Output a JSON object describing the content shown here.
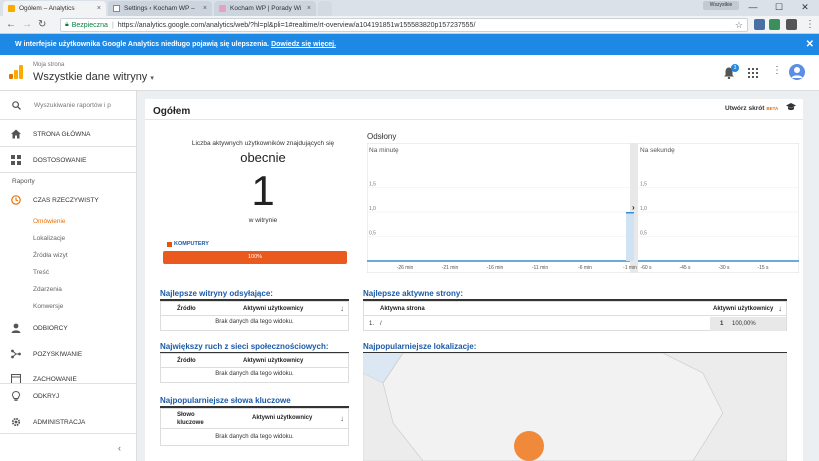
{
  "browser": {
    "tabs": [
      {
        "title": "Ogółem – Analytics",
        "close": "×"
      },
      {
        "title": "Settings ‹ Kocham WP –",
        "close": "×"
      },
      {
        "title": "Kocham WP | Porady Wi",
        "close": "×"
      }
    ],
    "user_chip": "Wszystkie",
    "window_controls": {
      "minimize": "—",
      "maximize": "☐",
      "close": "✕"
    },
    "nav": {
      "back": "←",
      "forward": "→",
      "reload": "↻"
    },
    "address": {
      "secure_label": "Bezpieczna",
      "url": "https://analytics.google.com/analytics/web/?hl=pl&pli=1#realtime/rt-overview/a104191851w155583820p157237555/",
      "star": "☆"
    }
  },
  "banner": {
    "text": "W interfejsie użytkownika Google Analytics niedługo pojawią się ulepszenia. ",
    "link": "Dowiedz się więcej.",
    "close": "✕"
  },
  "header": {
    "property_small": "Moja strona",
    "property_big": "Wszystkie dane witryny",
    "caret": "▾",
    "notifications_count": "3",
    "kebab": "⋮"
  },
  "sidebar": {
    "search_placeholder": "Wyszukiwanie raportów i p",
    "home": "Strona główna",
    "customization": "Dostosowanie",
    "reports_heading": "Raporty",
    "realtime": "Czas rzeczywisty",
    "realtime_items": [
      "Omówienie",
      "Lokalizacje",
      "Źródła wizyt",
      "Treść",
      "Zdarzenia",
      "Konwersje"
    ],
    "audience": "Odbiorcy",
    "acquisition": "Pozyskiwanie",
    "behavior": "Zachowanie",
    "discover": "Odkryj",
    "admin": "Administracja",
    "collapse": "‹"
  },
  "main": {
    "title": "Ogółem",
    "create_shortcut": "Utwórz skrót",
    "beta": "BETA",
    "active_users_label": "Liczba aktywnych użytkowników znajdujących się",
    "now": "obecnie",
    "active_count": "1",
    "on_site": "w witrynie",
    "device_label": "KOMPUTERY",
    "device_percent": "100%",
    "device_share": 1.0,
    "pageviews_title": "Odsłony",
    "referrers": {
      "title": "Najlepsze witryny odsyłające:",
      "col1": "Źródło",
      "col2": "Aktywni użytkownicy",
      "sort": "↓",
      "empty": "Brak danych dla tego widoku."
    },
    "social": {
      "title": "Największy ruch z sieci społecznościowych:",
      "col1": "Źródło",
      "col2": "Aktywni użytkownicy",
      "empty": "Brak danych dla tego widoku."
    },
    "keywords": {
      "title": "Najpopularniejsze słowa kluczowe",
      "col1": "Słowo kluczowe",
      "col2": "Aktywni użytkownicy",
      "sort": "↓",
      "empty": "Brak danych dla tego widoku."
    },
    "top_pages": {
      "title": "Najlepsze aktywne strony:",
      "col1": "Aktywna strona",
      "col2": "Aktywni użytkownicy",
      "sort": "↓",
      "rows": [
        {
          "num": "1.",
          "page": "/",
          "users": "1",
          "pct": "100,00%"
        }
      ]
    },
    "locations_title": "Najpopularniejsze lokalizacje:"
  },
  "chart_data": [
    {
      "type": "bar",
      "title": "Na minutę",
      "x": [
        "-26 min",
        "-21 min",
        "-16 min",
        "-11 min",
        "-6 min",
        "-1 min"
      ],
      "yticks": [
        "1,5",
        "1,0",
        "0,5"
      ],
      "ylim": [
        0,
        2
      ],
      "values_by_minute_ago": [
        {
          "minute": -1,
          "value": 1
        }
      ],
      "grid": true
    },
    {
      "type": "bar",
      "title": "Na sekundę",
      "x": [
        "-60 s",
        "-45 s",
        "-30 s",
        "-15 s"
      ],
      "yticks": [
        "1,5",
        "1,0",
        "0,5"
      ],
      "ylim": [
        0,
        2
      ],
      "values": [],
      "grid": true
    }
  ]
}
